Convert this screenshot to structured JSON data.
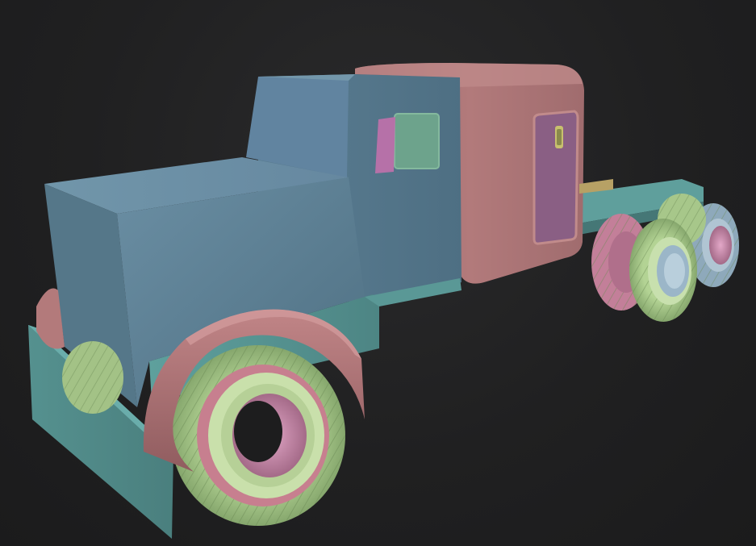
{
  "scene": {
    "subject": "truck-model",
    "background_color": "#1f1f20",
    "colors": {
      "body_blue": "#5e8297",
      "body_blue_dark": "#4a6a7d",
      "body_blue_light": "#7092a6",
      "cab_pink": "#b37a7b",
      "cab_pink_dark": "#8e5c5e",
      "frame_teal": "#5d9a98",
      "frame_teal_dark": "#477a79",
      "tire_green": "#a8c98a",
      "tire_green_dark": "#7a9a62",
      "rim_pink": "#c48aa6",
      "door_purple": "#8a5f84",
      "window_green": "#6da38c",
      "window_magenta": "#b671a8",
      "hub_blue": "#9bb6c8"
    }
  }
}
